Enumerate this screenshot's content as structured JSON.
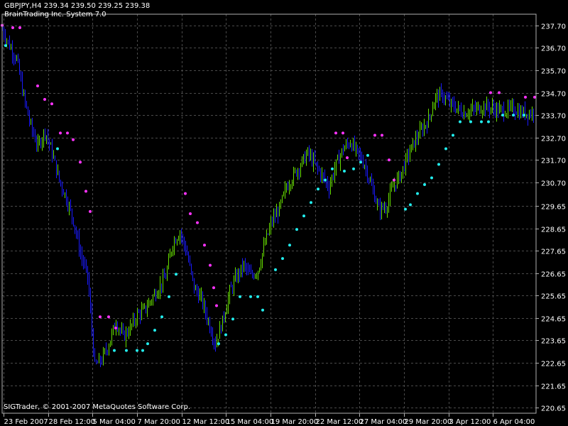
{
  "header": {
    "symbol_line": "GBPJPY,H4  239.34 239.50 239.25 239.38",
    "indicator_line": "BrainTrading Inc. System 7.0"
  },
  "footer": {
    "copyright": "SIGTrader, © 2001-2007 MetaQuotes Software Corp."
  },
  "colors": {
    "background": "#000000",
    "grid": "#4a4a4a",
    "axis_text": "#ffffff",
    "bull_bar": "#66dd00",
    "bear_bar": "#1a1aff",
    "dot_upper": "#ff33ff",
    "dot_lower": "#22eeee"
  },
  "chart_data": {
    "type": "line",
    "title": "GBPJPY,H4",
    "subtitle": "BrainTrading Inc. System 7.0",
    "ylim": [
      220.4,
      238.2
    ],
    "y_ticks": [
      "237.70",
      "236.70",
      "235.70",
      "234.70",
      "233.70",
      "232.70",
      "231.70",
      "230.70",
      "229.65",
      "228.65",
      "227.65",
      "226.65",
      "225.65",
      "224.65",
      "223.65",
      "222.65",
      "221.65",
      "220.65"
    ],
    "x_ticks": [
      "23 Feb 2007",
      "28 Feb 12:00",
      "5 Mar 04:00",
      "7 Mar 20:00",
      "12 Mar 12:00",
      "15 Mar 04:00",
      "19 Mar 20:00",
      "22 Mar 12:00",
      "27 Mar 04:00",
      "29 Mar 20:00",
      "3 Apr 12:00",
      "6 Apr 04:00"
    ],
    "grid": true,
    "series": [
      {
        "name": "",
        "x": [
          0,
          10,
          20,
          30,
          40,
          50,
          60,
          70,
          80,
          90,
          100,
          110,
          120,
          130,
          140,
          150,
          160,
          170,
          180,
          190,
          200,
          210,
          220,
          230,
          240,
          250,
          260,
          270,
          280,
          290,
          300,
          310,
          320,
          330,
          340,
          350,
          360,
          370,
          380,
          390,
          400,
          410,
          420,
          430,
          440,
          450,
          460,
          470,
          480,
          490,
          500,
          510,
          520,
          530,
          540,
          550,
          560,
          570,
          580,
          590,
          600,
          610,
          620,
          630,
          640,
          650,
          660,
          670,
          680,
          690,
          700,
          710,
          720,
          730,
          740
        ],
        "values": [
          237.5,
          236.8,
          236.2,
          234.5,
          233.2,
          232.3,
          233.0,
          232.0,
          230.8,
          230.0,
          229.0,
          227.5,
          226.5,
          222.5,
          222.8,
          223.5,
          224.5,
          223.8,
          224.2,
          224.8,
          225.0,
          225.5,
          226.0,
          226.5,
          228.0,
          228.5,
          227.5,
          226.0,
          225.5,
          224.5,
          223.5,
          224.5,
          225.8,
          226.5,
          227.0,
          226.5,
          226.8,
          228.0,
          229.0,
          229.5,
          230.5,
          231.0,
          231.5,
          232.0,
          231.5,
          231.0,
          230.5,
          231.5,
          232.2,
          232.5,
          232.0,
          231.5,
          230.5,
          229.5,
          229.6,
          230.5,
          231.0,
          231.8,
          232.5,
          233.0,
          233.5,
          234.5,
          234.6,
          234.2,
          234.0,
          233.8,
          233.9,
          234.0,
          234.1,
          234.0,
          233.9,
          233.9,
          234.0,
          233.8,
          233.8
        ]
      }
    ],
    "upper_dots": [
      {
        "x": 0,
        "y": 237.7
      },
      {
        "x": 15,
        "y": 237.6
      },
      {
        "x": 25,
        "y": 237.6
      },
      {
        "x": 50,
        "y": 235.0
      },
      {
        "x": 60,
        "y": 234.4
      },
      {
        "x": 70,
        "y": 234.2
      },
      {
        "x": 82,
        "y": 232.9
      },
      {
        "x": 92,
        "y": 232.9
      },
      {
        "x": 100,
        "y": 232.6
      },
      {
        "x": 110,
        "y": 231.6
      },
      {
        "x": 118,
        "y": 230.3
      },
      {
        "x": 124,
        "y": 229.4
      },
      {
        "x": 138,
        "y": 224.7
      },
      {
        "x": 150,
        "y": 224.7
      },
      {
        "x": 160,
        "y": 224.2
      },
      {
        "x": 258,
        "y": 230.2
      },
      {
        "x": 265,
        "y": 229.3
      },
      {
        "x": 275,
        "y": 228.9
      },
      {
        "x": 285,
        "y": 227.9
      },
      {
        "x": 293,
        "y": 227.0
      },
      {
        "x": 298,
        "y": 226.0
      },
      {
        "x": 302,
        "y": 225.2
      },
      {
        "x": 470,
        "y": 232.9
      },
      {
        "x": 480,
        "y": 232.9
      },
      {
        "x": 486,
        "y": 231.8
      },
      {
        "x": 525,
        "y": 232.8
      },
      {
        "x": 535,
        "y": 232.8
      },
      {
        "x": 545,
        "y": 231.7
      },
      {
        "x": 552,
        "y": 230.8
      },
      {
        "x": 688,
        "y": 234.7
      },
      {
        "x": 700,
        "y": 234.7
      },
      {
        "x": 737,
        "y": 234.5
      },
      {
        "x": 750,
        "y": 234.5
      }
    ],
    "lower_dots": [
      {
        "x": 5,
        "y": 236.8
      },
      {
        "x": 78,
        "y": 232.2
      },
      {
        "x": 158,
        "y": 223.2
      },
      {
        "x": 175,
        "y": 223.2
      },
      {
        "x": 190,
        "y": 223.2
      },
      {
        "x": 198,
        "y": 223.2
      },
      {
        "x": 205,
        "y": 223.5
      },
      {
        "x": 215,
        "y": 224.1
      },
      {
        "x": 225,
        "y": 224.7
      },
      {
        "x": 235,
        "y": 225.6
      },
      {
        "x": 245,
        "y": 226.6
      },
      {
        "x": 305,
        "y": 223.5
      },
      {
        "x": 315,
        "y": 223.9
      },
      {
        "x": 325,
        "y": 224.6
      },
      {
        "x": 335,
        "y": 225.6
      },
      {
        "x": 350,
        "y": 225.6
      },
      {
        "x": 360,
        "y": 225.6
      },
      {
        "x": 367,
        "y": 225.0
      },
      {
        "x": 385,
        "y": 226.8
      },
      {
        "x": 395,
        "y": 227.3
      },
      {
        "x": 405,
        "y": 227.9
      },
      {
        "x": 415,
        "y": 228.6
      },
      {
        "x": 425,
        "y": 229.2
      },
      {
        "x": 435,
        "y": 229.8
      },
      {
        "x": 445,
        "y": 230.4
      },
      {
        "x": 455,
        "y": 230.8
      },
      {
        "x": 465,
        "y": 231.3
      },
      {
        "x": 482,
        "y": 231.2
      },
      {
        "x": 495,
        "y": 231.3
      },
      {
        "x": 505,
        "y": 231.6
      },
      {
        "x": 515,
        "y": 231.9
      },
      {
        "x": 568,
        "y": 229.5
      },
      {
        "x": 575,
        "y": 229.7
      },
      {
        "x": 585,
        "y": 230.2
      },
      {
        "x": 595,
        "y": 230.6
      },
      {
        "x": 605,
        "y": 230.9
      },
      {
        "x": 615,
        "y": 231.5
      },
      {
        "x": 625,
        "y": 232.2
      },
      {
        "x": 635,
        "y": 232.8
      },
      {
        "x": 645,
        "y": 233.4
      },
      {
        "x": 660,
        "y": 233.4
      },
      {
        "x": 675,
        "y": 233.4
      },
      {
        "x": 685,
        "y": 233.4
      },
      {
        "x": 705,
        "y": 233.7
      },
      {
        "x": 720,
        "y": 233.7
      },
      {
        "x": 735,
        "y": 233.7
      }
    ]
  }
}
